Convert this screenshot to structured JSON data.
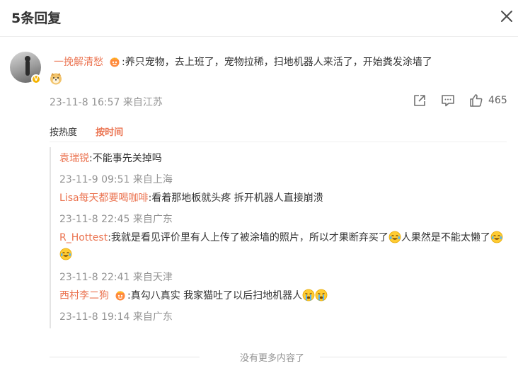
{
  "header": {
    "title": "5条回复"
  },
  "main_comment": {
    "username": "一挽解清愁",
    "text": ":养只宠物，去上班了，宠物拉稀，扫地机器人来活了，开始粪发涂墙了",
    "date": "23-11-8 16:57",
    "location": "来自江苏",
    "like_count": "465"
  },
  "sort": {
    "hot_label": "按热度",
    "time_label": "按时间"
  },
  "replies": [
    {
      "username": "袁瑞锐",
      "text": ":不能事先关掉吗",
      "date": "23-11-9 09:51",
      "location": "来自上海"
    },
    {
      "username": "Lisa每天都要喝咖啡",
      "text": ":看着那地板就头疼 拆开机器人直接崩溃",
      "date": "23-11-8 22:45",
      "location": "来自广东"
    },
    {
      "username": "R_Hottest",
      "text": ":我就是看见评价里有人上传了被涂墙的照片，所以才果断弃买了",
      "text_after_emoji": "人果然是不能太懒了",
      "date": "23-11-8 22:41",
      "location": "来自天津"
    },
    {
      "username": "西村李二狗",
      "text": ":真勾八真实  我家猫吐了以后扫地机器人",
      "date": "23-11-8 19:14",
      "location": "来自广东"
    }
  ],
  "footer": {
    "end_text": "没有更多内容了"
  },
  "icons": {
    "close": "close-icon",
    "share": "share-icon",
    "comment": "comment-icon",
    "like": "thumbs-up-icon",
    "vip": "vip-crown-icon",
    "verified": "verified-badge-icon",
    "emoji_dog": "doge-emoji",
    "emoji_laugh_cry": "laugh-cry-emoji",
    "emoji_cry": "crying-emoji"
  },
  "colors": {
    "username": "#eb7350",
    "meta": "#939393",
    "accent": "#eb7350"
  }
}
